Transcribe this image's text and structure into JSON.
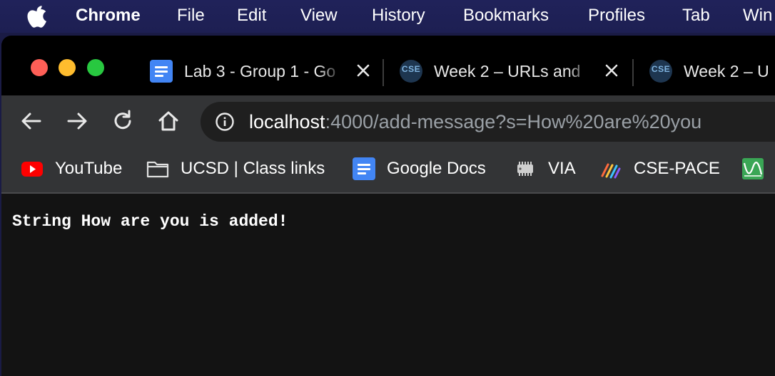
{
  "menubar": {
    "app_name": "Chrome",
    "items": [
      "File",
      "Edit",
      "View",
      "History",
      "Bookmarks",
      "Profiles",
      "Tab",
      "Win"
    ]
  },
  "tabs": [
    {
      "title": "Lab 3 - Group 1 - Go",
      "favicon": "google-docs-icon"
    },
    {
      "title": "Week 2 – URLs and",
      "favicon": "cse-icon"
    },
    {
      "title": "Week 2 – U",
      "favicon": "cse-icon"
    }
  ],
  "favicon_text": {
    "cse": "CSE"
  },
  "address_bar": {
    "host": "localhost",
    "rest": ":4000/add-message?s=How%20are%20you"
  },
  "bookmarks": [
    {
      "label": "YouTube",
      "icon": "youtube-icon"
    },
    {
      "label": "UCSD | Class links",
      "icon": "folder-icon"
    },
    {
      "label": "Google Docs",
      "icon": "google-docs-icon"
    },
    {
      "label": "VIA",
      "icon": "chip-icon"
    },
    {
      "label": "CSE-PACE",
      "icon": "pace-icon"
    }
  ],
  "page": {
    "message": "String How are you is added!"
  },
  "colors": {
    "menubar": "#1d1f52",
    "tabstrip": "#000000",
    "toolbar": "#333436",
    "omnibox": "#1f1f1f",
    "page_background": "#131313",
    "traffic_red": "#fe5f57",
    "traffic_yellow": "#febc2e",
    "traffic_green": "#28c840"
  }
}
